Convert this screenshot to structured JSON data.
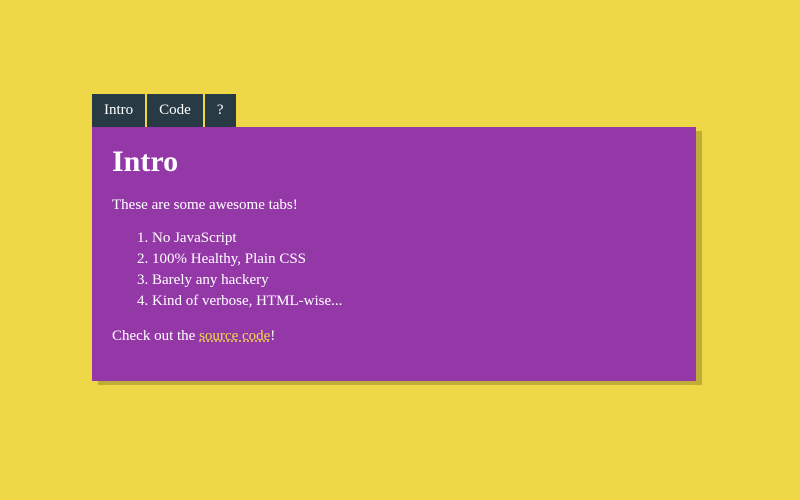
{
  "tabs": [
    {
      "label": "Intro"
    },
    {
      "label": "Code"
    },
    {
      "label": "?"
    }
  ],
  "panel": {
    "heading": "Intro",
    "intro_text": "These are some awesome tabs!",
    "items": [
      "No JavaScript",
      "100% Healthy, Plain CSS",
      "Barely any hackery",
      "Kind of verbose, HTML-wise..."
    ],
    "closing_before": "Check out the ",
    "link_text": "source code",
    "closing_after": "!"
  }
}
